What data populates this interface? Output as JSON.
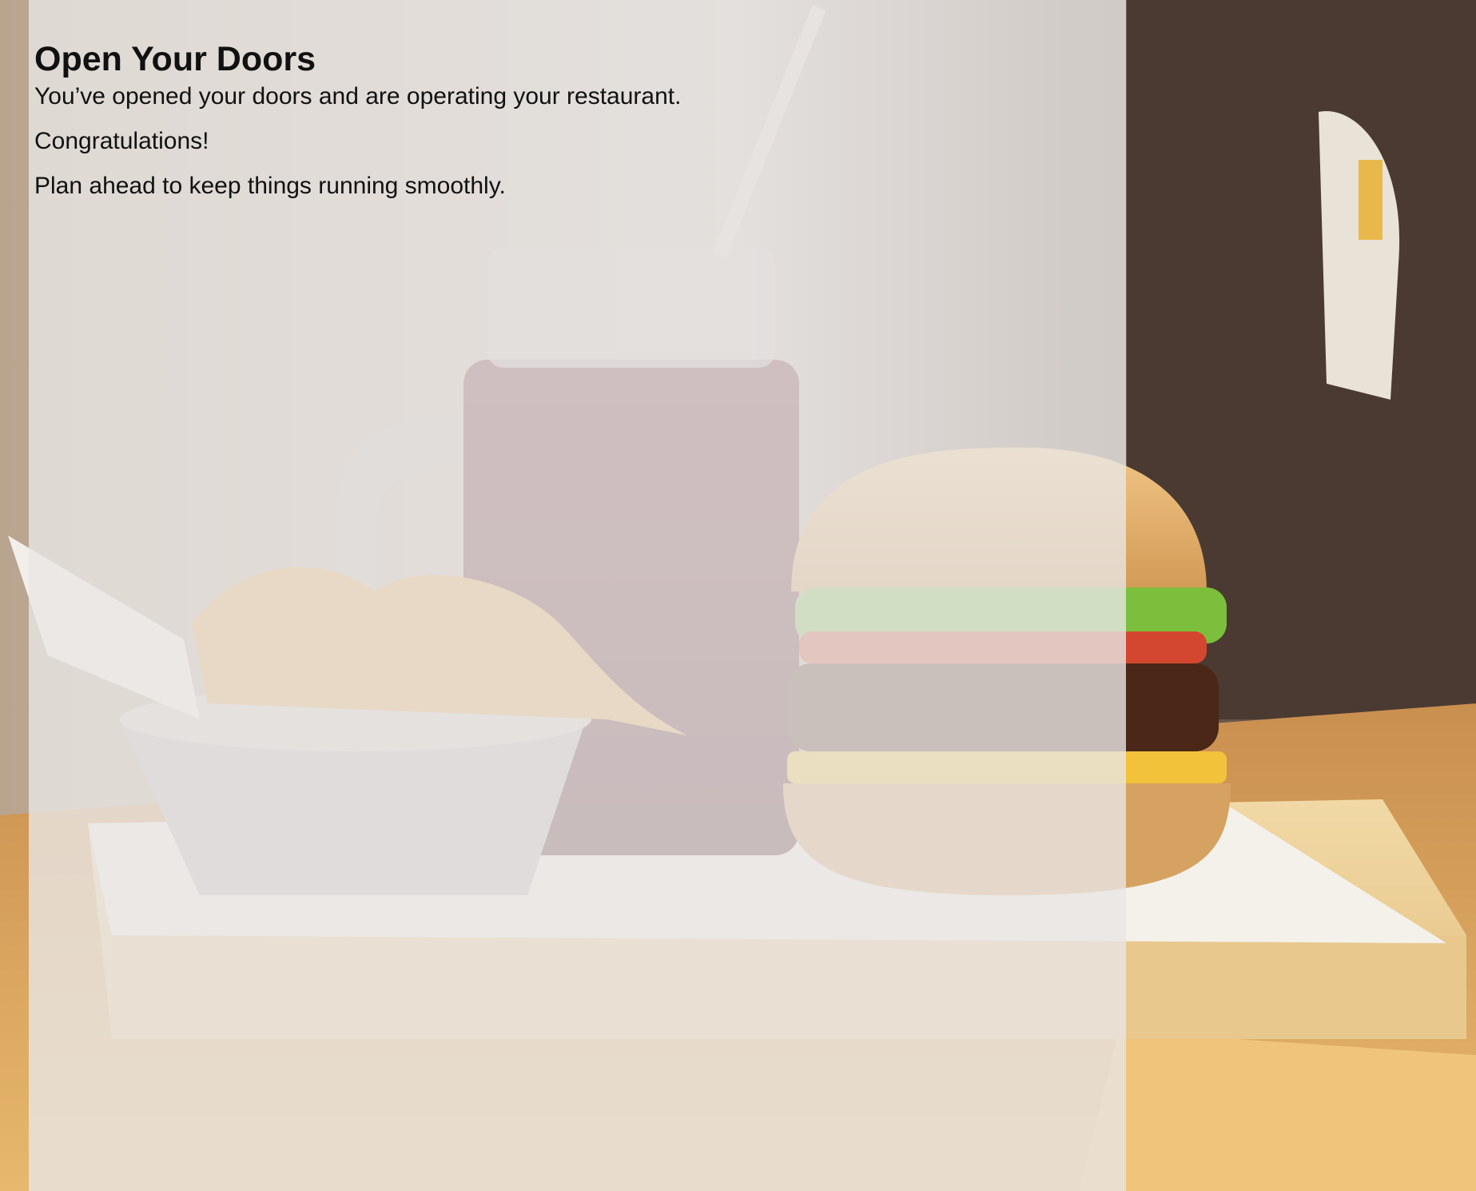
{
  "slide": {
    "title": "Open Your Doors",
    "paragraphs": [
      "You’ve opened your doors and are operating your restaurant.",
      "Congratulations!",
      "Plan ahead to keep things running smoothly."
    ]
  },
  "background": {
    "subject": "burger, curly fries and a drink on a wooden serving board",
    "overlay_color": "#e8e6e5"
  }
}
